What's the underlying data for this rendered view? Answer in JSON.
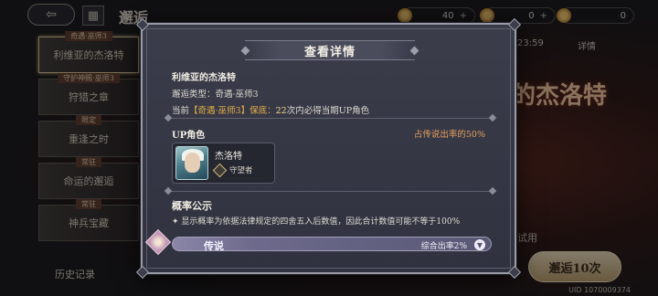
{
  "screen": {
    "title": "邂逅",
    "back_icon": "back-arrow-icon",
    "resources": [
      {
        "value": "40",
        "plus": "+"
      },
      {
        "value": "0",
        "plus": "+"
      },
      {
        "value": "0",
        "plus": ""
      }
    ],
    "banners": [
      {
        "tag": "奇遇·巫师3",
        "label": "利维亚的杰洛特"
      },
      {
        "tag": "守护神赐·巫师3",
        "label": "狩猎之章"
      },
      {
        "tag": "限定",
        "label": "重逢之时"
      },
      {
        "tag": "常驻",
        "label": "命运的邂逅"
      },
      {
        "tag": "常驻",
        "label": "神兵宝藏"
      }
    ],
    "history_label": "历史记录",
    "timer_text": "23:59",
    "detail_link": "详情",
    "hero_name_display": "的杰洛特",
    "trial_label": "试用",
    "summon_button": "邂逅10次",
    "uid": "UID 1070009374"
  },
  "modal": {
    "title": "查看详情",
    "banner_name": "利维亚的杰洛特",
    "banner_type_label": "邂逅类型：",
    "banner_type_value": "奇遇·巫师3",
    "guarantee_prefix": "当前",
    "guarantee_tag": "【奇遇·巫师3】保底：",
    "guarantee_count": "22",
    "guarantee_suffix": "次内必得当期UP角色",
    "up_section_label": "UP角色",
    "up_rate_text": "占传说出率的50%",
    "up_hero": {
      "name": "杰洛特",
      "role": "守望者",
      "role_icon": "guardian-role-icon"
    },
    "prob_title": "概率公示",
    "prob_note": "✦ 显示概率为依据法律规定的四舍五入后数值，因此合计数值可能不等于100%",
    "rarity_rows": [
      {
        "label": "传说",
        "rate_text": "综合出率2%",
        "expand_icon": "chevron-down-icon"
      }
    ]
  }
}
